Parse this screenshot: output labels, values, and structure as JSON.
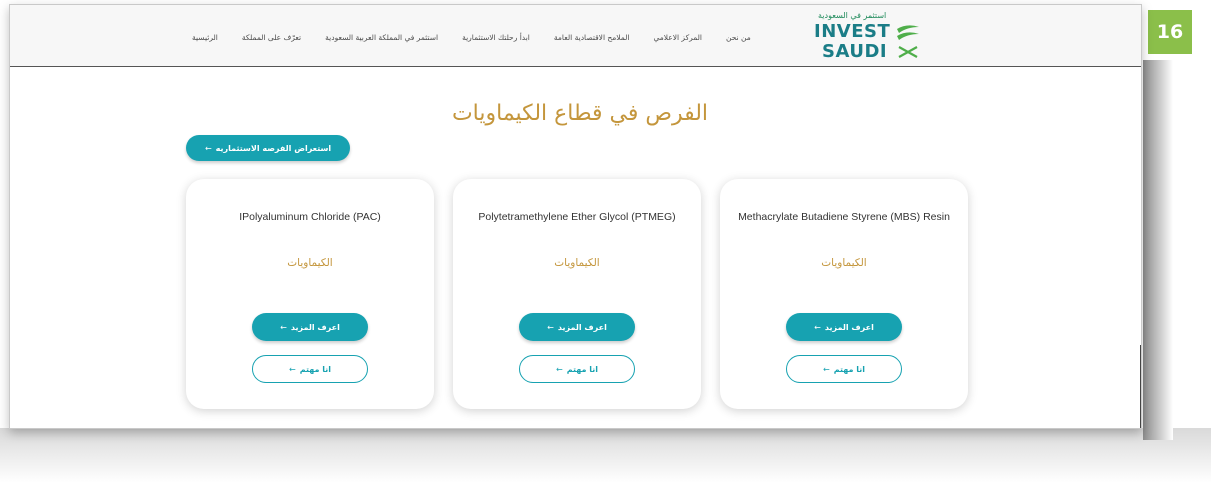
{
  "page_number": "16",
  "header": {
    "logo": {
      "arabic": "استثمر في السعودية",
      "line1": "INVEST",
      "line2": "SAUDI"
    },
    "nav": [
      {
        "label": "الرئيسية"
      },
      {
        "label": "تعرّف على المملكة"
      },
      {
        "label": "استثمر في المملكة العربية السعودية"
      },
      {
        "label": "ابدأ رحلتك الاستثمارية"
      },
      {
        "label": "الملامح الاقتصادية العامة"
      },
      {
        "label": "المركز الاعلامي"
      },
      {
        "label": "من نحن"
      }
    ]
  },
  "main": {
    "title": "الفرص في قطاع الكيماويات",
    "browse_button": "استعراض الفرصه الاستثماريه",
    "arrow": "←",
    "cards": [
      {
        "name": "Methacrylate Butadiene Styrene (MBS) Resin",
        "category": "الكيماويات",
        "more": "اعرف المزيد",
        "interested": "انا مهتم"
      },
      {
        "name": "Polytetramethylene Ether Glycol (PTMEG)",
        "category": "الكيماويات",
        "more": "اعرف المزيد",
        "interested": "انا مهتم"
      },
      {
        "name": "IPolyaluminum Chloride (PAC)",
        "category": "الكيماويات",
        "more": "اعرف المزيد",
        "interested": "انا مهتم"
      }
    ]
  },
  "colors": {
    "accent": "#17a2b1",
    "gold": "#c4963c",
    "badge": "#8bbf4a"
  }
}
